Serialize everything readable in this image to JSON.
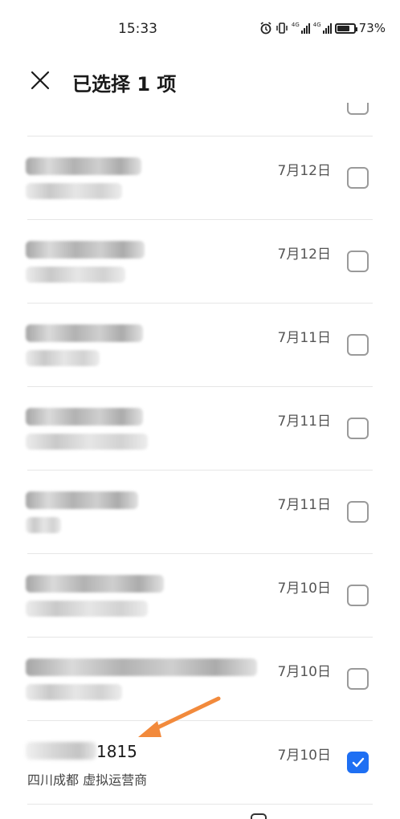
{
  "status_bar": {
    "time": "15:33",
    "network_label": "4G",
    "battery": "73%"
  },
  "header": {
    "title": "已选择 1 项"
  },
  "rows": [
    {
      "date": "7月12日",
      "checked": false,
      "redacted": true
    },
    {
      "date": "7月12日",
      "checked": false,
      "redacted": true
    },
    {
      "date": "7月11日",
      "checked": false,
      "redacted": true
    },
    {
      "date": "7月11日",
      "checked": false,
      "redacted": true
    },
    {
      "date": "7月11日",
      "checked": false,
      "redacted": true
    },
    {
      "date": "7月10日",
      "checked": false,
      "redacted": true
    },
    {
      "date": "7月10日",
      "checked": false,
      "redacted": true
    },
    {
      "number_visible": "1815",
      "location": "四川成都 虚拟运营商",
      "date": "7月10日",
      "checked": true,
      "redacted": false
    }
  ],
  "colors": {
    "accent": "#1e6ff3",
    "arrow": "#f28a3c",
    "divider": "#e6e6e6"
  }
}
